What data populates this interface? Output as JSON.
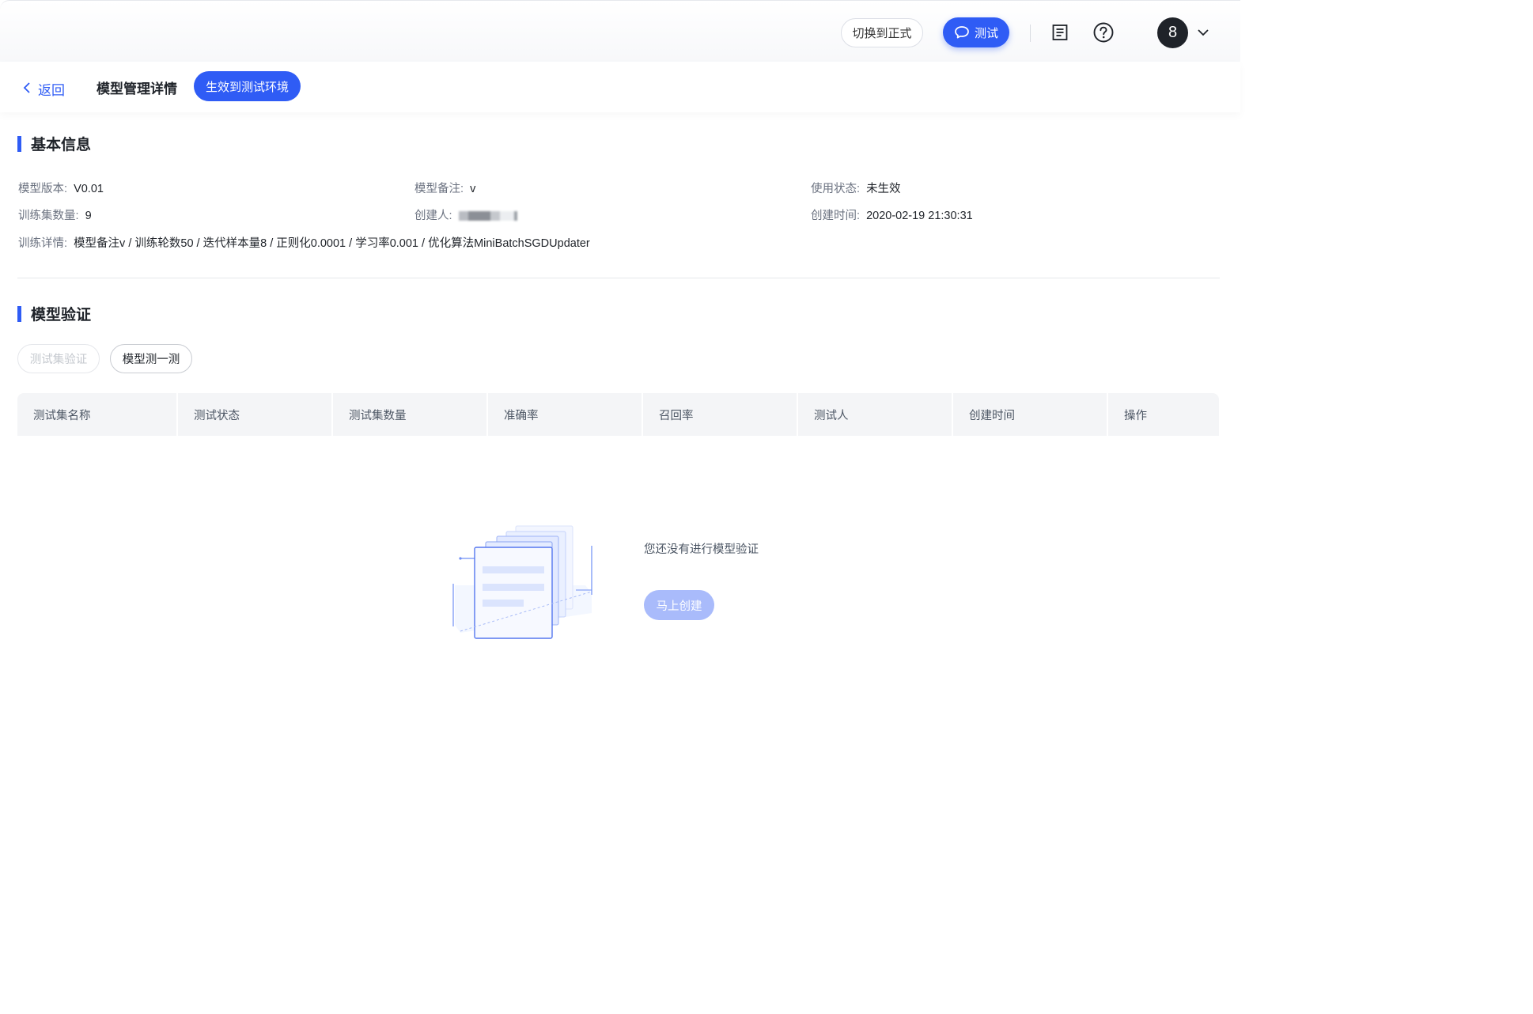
{
  "topbar": {
    "switch_label": "切换到正式",
    "test_label": "测试",
    "avatar_text": "8"
  },
  "header": {
    "back_label": "返回",
    "title": "模型管理详情",
    "deploy_label": "生效到测试环境"
  },
  "basic_info": {
    "title": "基本信息",
    "version_label": "模型版本:",
    "version_value": "V0.01",
    "note_label": "模型备注:",
    "note_value": "v",
    "status_label": "使用状态:",
    "status_value": "未生效",
    "trainset_label": "训练集数量:",
    "trainset_value": "9",
    "creator_label": "创建人:",
    "created_label": "创建时间:",
    "created_value": "2020-02-19 21:30:31",
    "detail_label": "训练详情:",
    "detail_value": "模型备注v / 训练轮数50 / 迭代样本量8 / 正则化0.0001 / 学习率0.001 / 优化算法MiniBatchSGDUpdater"
  },
  "validation": {
    "title": "模型验证",
    "testset_verify_label": "测试集验证",
    "model_test_label": "模型测一测",
    "columns": [
      "测试集名称",
      "测试状态",
      "测试集数量",
      "准确率",
      "召回率",
      "测试人",
      "创建时间",
      "操作"
    ],
    "empty_text": "您还没有进行模型验证",
    "create_label": "马上创建"
  },
  "colors": {
    "primary": "#2f5cf5",
    "primary_disabled": "#a9bbfb",
    "header_bg": "#f4f5f7"
  }
}
